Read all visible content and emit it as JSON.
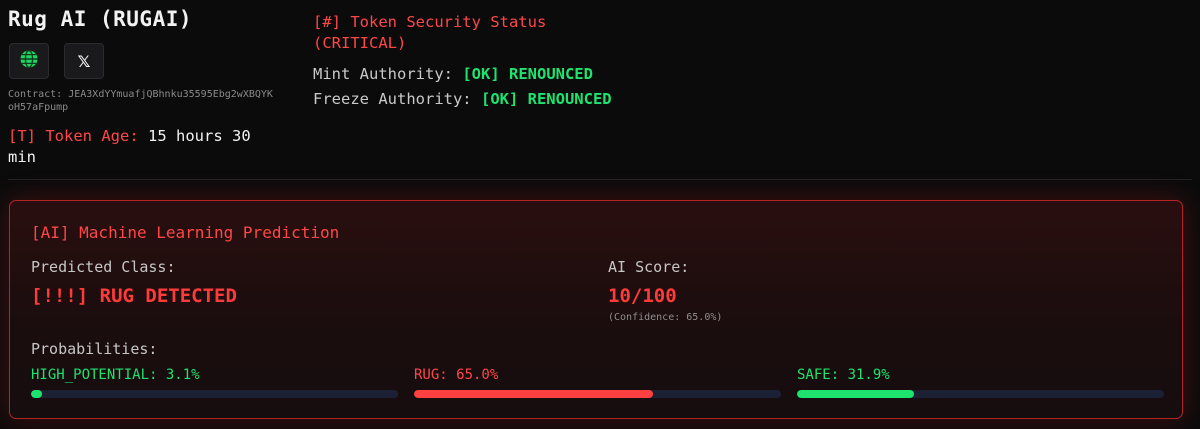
{
  "header": {
    "title": "Rug AI (RUGAI)",
    "contract_label": "Contract:",
    "contract_address": "JEA3XdYYmuafjQBhnku35595Ebg2wXBQYKoH57aFpump",
    "age_label": "[T] Token Age:",
    "age_value": "15 hours 30 min",
    "links": [
      {
        "icon": "globe-icon",
        "label": "Website"
      },
      {
        "icon": "x-logo-icon",
        "glyph": "𝕏"
      }
    ]
  },
  "security": {
    "heading": "[#] Token Security Status (CRITICAL)",
    "mint_label": "Mint Authority:",
    "mint_status": "[OK] RENOUNCED",
    "freeze_label": "Freeze Authority:",
    "freeze_status": "[OK] RENOUNCED"
  },
  "prediction": {
    "title": "[AI] Machine Learning Prediction",
    "class_label": "Predicted Class:",
    "class_value": "[!!!] RUG DETECTED",
    "score_label": "AI Score:",
    "score_value": "10/100",
    "confidence": "(Confidence: 65.0%)",
    "probabilities_label": "Probabilities:",
    "probabilities": [
      {
        "label": "HIGH_POTENTIAL: 3.1%",
        "value": 0.031,
        "color": "#1ee36f"
      },
      {
        "label": "RUG: 65.0%",
        "value": 0.65,
        "color": "#ff4040"
      },
      {
        "label": "SAFE: 31.9%",
        "value": 0.319,
        "color": "#1ee36f"
      }
    ]
  },
  "colors": {
    "accent_red": "#ff4747",
    "ok_green": "#1ee36f",
    "background": "#0b0b0c"
  }
}
